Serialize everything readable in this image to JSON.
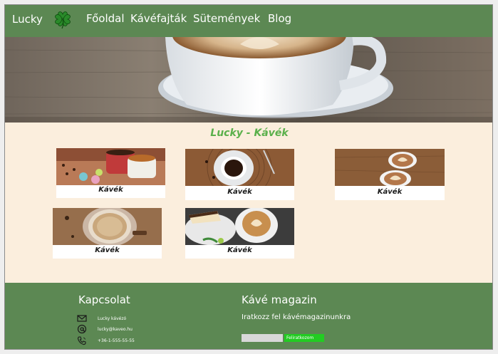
{
  "nav": {
    "brand": "Lucky",
    "logo_icon": "four-leaf-clover-icon",
    "menu": [
      "Főoldal",
      "Kávéfajták",
      "Sütemények",
      "Blog"
    ]
  },
  "main": {
    "title": "Lucky - Kávék",
    "cards": [
      {
        "caption": "Kávék",
        "image": "coffee-cups-macarons-photo"
      },
      {
        "caption": "Kávék",
        "image": "espresso-on-wood-photo"
      },
      {
        "caption": "Kávék",
        "image": "latte-art-cups-photo"
      },
      {
        "caption": "Kávék",
        "image": "cappuccino-top-view-photo"
      },
      {
        "caption": "Kávék",
        "image": "latte-and-cake-photo"
      }
    ]
  },
  "footer": {
    "contact_title": "Kapcsolat",
    "contact": [
      {
        "icon": "envelope-icon",
        "text": "Lucky kávézó"
      },
      {
        "icon": "at-sign-icon",
        "text": "lucky@kaveo.hu"
      },
      {
        "icon": "phone-icon",
        "text": "+36-1-555-55-55"
      }
    ],
    "magazine_title": "Kávé magazin",
    "magazine_text": "Iratkozz fel kávémagazinunkra",
    "subscribe_value": "",
    "subscribe_button": "Feliratkozom"
  },
  "colors": {
    "primary": "#5c8853",
    "page_bg": "#fbeedd",
    "title_green": "#5ab04b",
    "button_green": "#22cc22"
  }
}
